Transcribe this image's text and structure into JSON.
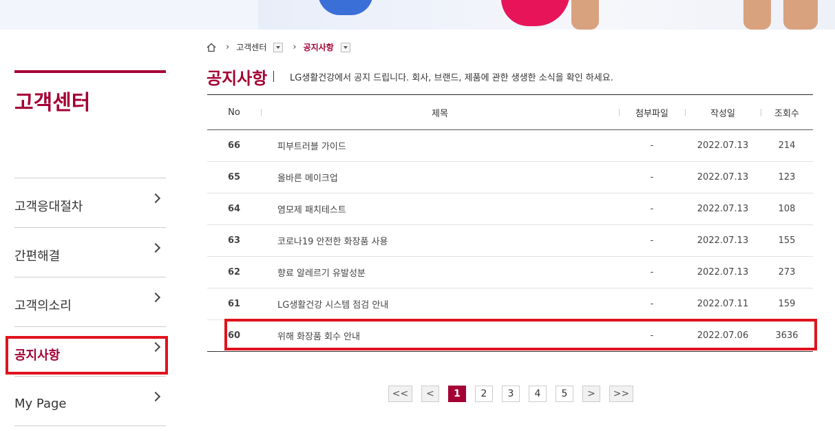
{
  "breadcrumb": {
    "section": "고객센터",
    "current": "공지사항"
  },
  "sidebar": {
    "title": "고객센터",
    "items": [
      {
        "label": "고객응대절차"
      },
      {
        "label": "간편해결"
      },
      {
        "label": "고객의소리"
      },
      {
        "label": "공지사항",
        "active": true
      },
      {
        "label": "My Page"
      }
    ]
  },
  "page": {
    "title": "공지사항",
    "description": "LG생활건강에서 공지 드립니다. 회사, 브랜드, 제품에 관한 생생한 소식을 확인 하세요."
  },
  "table": {
    "headers": {
      "no": "No",
      "title": "제목",
      "file": "첨부파일",
      "date": "작성일",
      "views": "조회수"
    },
    "rows": [
      {
        "no": "66",
        "title": "피부트러블 가이드",
        "file": "-",
        "date": "2022.07.13",
        "views": "214"
      },
      {
        "no": "65",
        "title": "올바른 메이크업",
        "file": "-",
        "date": "2022.07.13",
        "views": "123"
      },
      {
        "no": "64",
        "title": "염모제 패치테스트",
        "file": "-",
        "date": "2022.07.13",
        "views": "108"
      },
      {
        "no": "63",
        "title": "코로나19 안전한 화장품 사용",
        "file": "-",
        "date": "2022.07.13",
        "views": "155"
      },
      {
        "no": "62",
        "title": "향료 알레르기 유발성분",
        "file": "-",
        "date": "2022.07.13",
        "views": "273"
      },
      {
        "no": "61",
        "title": "LG생활건강 시스템 점검 안내",
        "file": "-",
        "date": "2022.07.11",
        "views": "159"
      },
      {
        "no": "60",
        "title": "위해 화장품 회수 안내",
        "file": "-",
        "date": "2022.07.06",
        "views": "3636"
      }
    ]
  },
  "pagination": {
    "first": "<<",
    "prev": "<",
    "next": ">",
    "last": ">>",
    "pages": [
      "1",
      "2",
      "3",
      "4",
      "5"
    ],
    "current": "1"
  },
  "colors": {
    "brand": "#a50034",
    "highlight": "#e0121e"
  }
}
